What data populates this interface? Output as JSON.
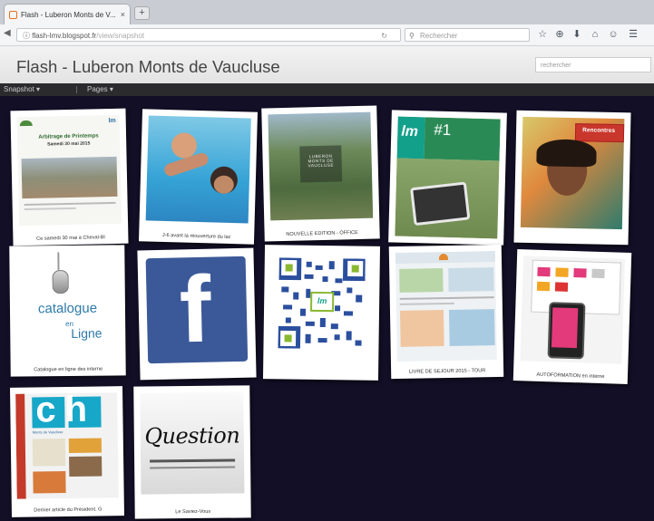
{
  "browser": {
    "tab_title": "Flash - Luberon Monts de V...",
    "tab_close": "×",
    "new_tab": "+",
    "url": "flash-lmv.blogspot.fr",
    "url_rest": "/view/snapshot",
    "reload": "↻",
    "search_placeholder": "Rechercher",
    "back": "◀",
    "info": "ⓘ",
    "toolbar_icons": [
      "☆",
      "⊕",
      "⬇",
      "⌂",
      "☺",
      "☰"
    ]
  },
  "blog": {
    "title": "Flash - Luberon Monts de Vaucluse",
    "search_placeholder": "rechercher"
  },
  "menu": {
    "view": "Snapshot ▾",
    "pages": "Pages ▾"
  },
  "posts": [
    {
      "caption": "Ce samedi 30 mai à Cheval-Bl",
      "inner_title": "Arbitrage de Printemps",
      "inner_date": "Samedi 30 mai 2015"
    },
    {
      "caption": "J-6 avant la réouverture du lac"
    },
    {
      "caption": "NOUVELLE EDITION - OFFICE",
      "inner_title": "LUBERON MONTS DE VAUCLUSE"
    },
    {
      "caption": "",
      "inner_title": "lm",
      "inner_number": "#1"
    },
    {
      "caption": "",
      "inner_title": "Rencontres"
    },
    {
      "caption": "Catalogue en ligne des interne",
      "inner_title": "catalogue",
      "inner_sub": "en",
      "inner_sub2": "Ligne"
    },
    {
      "caption": "",
      "inner_title": "f"
    },
    {
      "caption": "",
      "inner_title": "lm"
    },
    {
      "caption": "LIVRE DE SEJOUR 2015 - TOUR"
    },
    {
      "caption": "AUTOFORMATION en interne"
    },
    {
      "caption": "Dernier article du Président. G",
      "inner_title": "ch",
      "inner_sub": "Monts de Vaucluse"
    },
    {
      "caption": "Le Saviez-Vous",
      "inner_title": "Question"
    }
  ]
}
